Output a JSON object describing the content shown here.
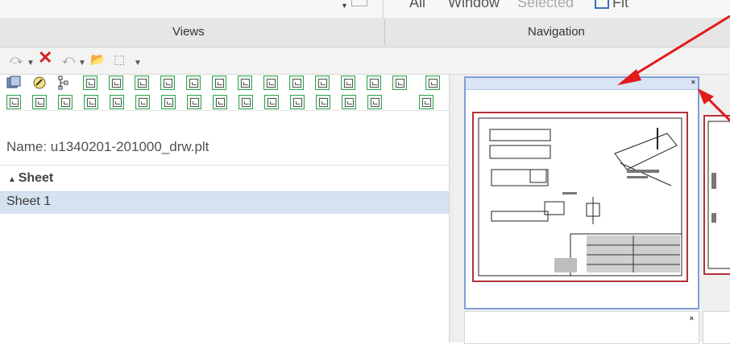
{
  "top_strip": {
    "all_label": "All",
    "window_label": "Window",
    "selected_label": "Selected",
    "fit_label": "Fit"
  },
  "tabs": {
    "views_label": "Views",
    "navigation_label": "Navigation"
  },
  "toolbar": {
    "redo_icon": "redo-icon",
    "delete_icon": "delete-icon",
    "undo_icon": "undo-icon",
    "open_icon": "open-folder-icon",
    "select_icon": "select-icon",
    "more_icon": "dropdown-icon"
  },
  "views": {
    "name_label": "Name: u1340201-201000_drw.plt",
    "sheet_header": "Sheet",
    "sheet_items": [
      "Sheet 1"
    ]
  },
  "navigation": {
    "close_glyph": "×"
  },
  "colors": {
    "accent": "#7f9fd6",
    "selected_row": "#d5e3f0",
    "drawing_border": "#b5303a",
    "arrow": "#e11b1b"
  }
}
